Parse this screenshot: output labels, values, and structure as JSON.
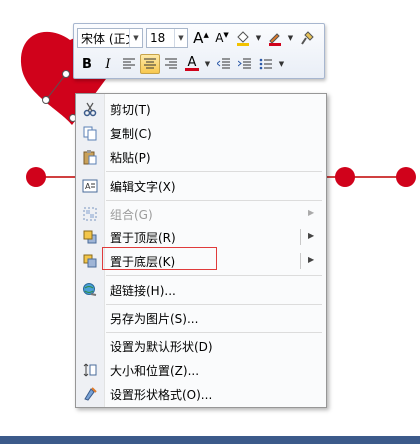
{
  "mini_toolbar": {
    "font_name": "宋体 (正文",
    "font_size": "18",
    "bold": "B",
    "italic": "I",
    "grow_font": "A",
    "shrink_font": "A",
    "font_color_letter": "A"
  },
  "context_menu": {
    "items": [
      {
        "label": "剪切(T)",
        "icon": "scissors-icon",
        "enabled": true,
        "submenu": false
      },
      {
        "label": "复制(C)",
        "icon": "copy-icon",
        "enabled": true,
        "submenu": false
      },
      {
        "label": "粘贴(P)",
        "icon": "paste-icon",
        "enabled": true,
        "submenu": false
      },
      {
        "label": "编辑文字(X)",
        "icon": "edit-text-icon",
        "enabled": true,
        "submenu": false
      },
      {
        "label": "组合(G)",
        "icon": "group-icon",
        "enabled": false,
        "submenu": true
      },
      {
        "label": "置于顶层(R)",
        "icon": "bring-to-front-icon",
        "enabled": true,
        "submenu": true
      },
      {
        "label": "置于底层(K)",
        "icon": "send-to-back-icon",
        "enabled": true,
        "submenu": true
      },
      {
        "label": "超链接(H)...",
        "icon": "hyperlink-icon",
        "enabled": true,
        "submenu": false
      },
      {
        "label": "另存为图片(S)...",
        "icon": "",
        "enabled": true,
        "submenu": false
      },
      {
        "label": "设置为默认形状(D)",
        "icon": "",
        "enabled": true,
        "submenu": false
      },
      {
        "label": "大小和位置(Z)...",
        "icon": "size-position-icon",
        "enabled": true,
        "submenu": false
      },
      {
        "label": "设置形状格式(O)...",
        "icon": "format-shape-icon",
        "enabled": true,
        "submenu": false
      }
    ]
  },
  "colors": {
    "shape_red": "#d0021b",
    "annotation_red": "#e03b3b",
    "line_red": "#c00000"
  }
}
